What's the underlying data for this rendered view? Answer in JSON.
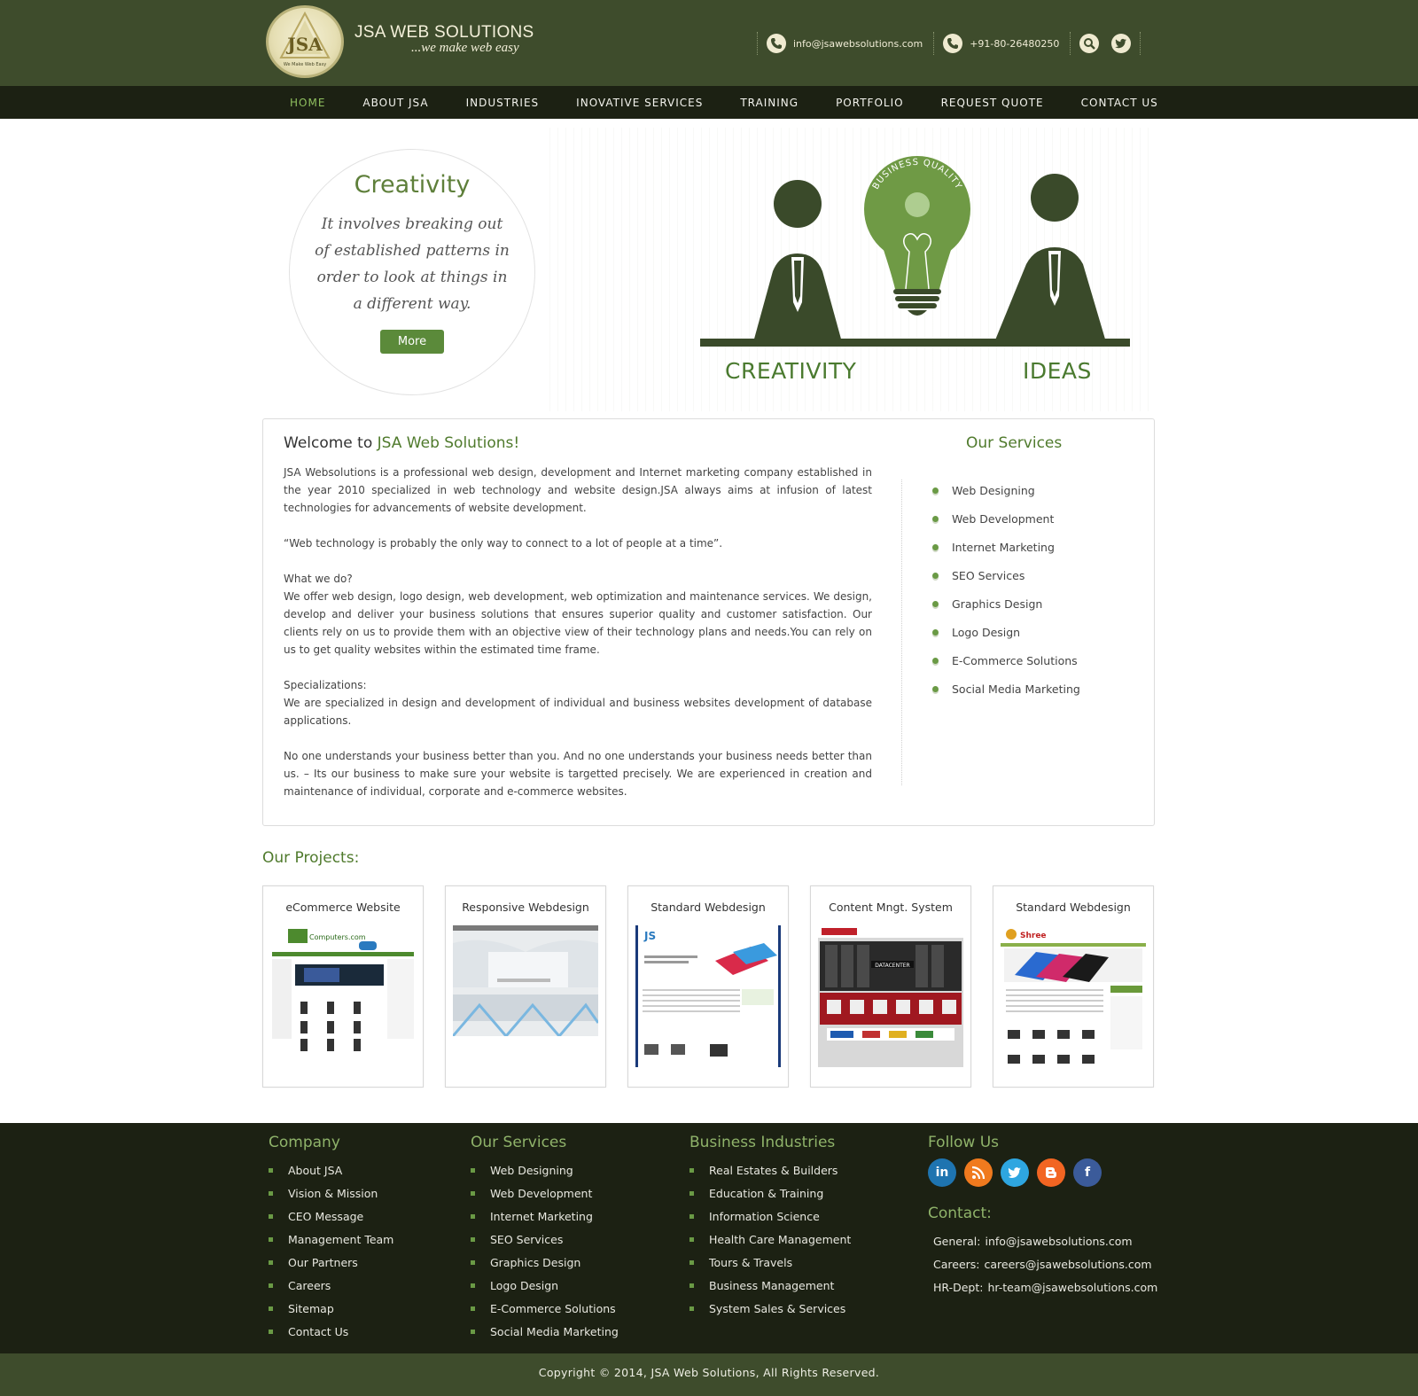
{
  "brand": {
    "name": "JSA WEB SOLUTIONS",
    "tagline": "...we make web easy",
    "logo_monogram": "JSA",
    "logo_motto": "We Make Web Easy"
  },
  "header_contacts": {
    "email": "info@jsawebsolutions.com",
    "phone": "+91-80-26480250"
  },
  "nav": {
    "items": [
      {
        "label": "HOME",
        "active": true
      },
      {
        "label": "ABOUT JSA",
        "active": false
      },
      {
        "label": "INDUSTRIES",
        "active": false
      },
      {
        "label": "INOVATIVE SERVICES",
        "active": false
      },
      {
        "label": "TRAINING",
        "active": false
      },
      {
        "label": "PORTFOLIO",
        "active": false
      },
      {
        "label": "REQUEST QUOTE",
        "active": false
      },
      {
        "label": "CONTACT US",
        "active": false
      }
    ]
  },
  "hero": {
    "title": "Creativity",
    "quote": "It involves breaking out of established patterns in order to look at things in a different way.",
    "button": "More",
    "bulb_text": "BUSINESS QUALITY",
    "label_left": "CREATIVITY",
    "label_right": "IDEAS"
  },
  "welcome": {
    "title_prefix": "Welcome to ",
    "title_brand": "JSA Web Solutions!",
    "p1": "JSA Websolutions is a professional web design, development and Internet marketing company established in the year 2010 specialized in web technology and website design.JSA always aims at infusion of latest technologies for advancements of website development.",
    "p2": "“Web technology is probably the only way to connect to a lot of people at a time”.",
    "p3_head": "What we do?",
    "p3": "We offer web design, logo design, web development, web optimization and maintenance services. We design, develop and deliver your business solutions that ensures superior quality and customer satisfaction. Our clients rely on us to provide them with an objective view of their technology plans and needs.You can rely on us to get quality websites within the estimated time frame.",
    "p4_head": "Specializations:",
    "p4": "We are specialized in design and development of individual and business websites development of database applications.",
    "p5": "No one understands your business better than you. And no one understands your business needs better than us. – Its our business to make sure your website is targetted precisely. We are experienced in creation and maintenance of individual, corporate and e-commerce websites."
  },
  "services": {
    "title": "Our Services",
    "items": [
      "Web Designing",
      "Web Development",
      "Internet Marketing",
      "SEO Services",
      "Graphics Design",
      "Logo Design",
      "E-Commerce Solutions",
      "Social Media Marketing"
    ]
  },
  "projects": {
    "title": "Our Projects:",
    "items": [
      {
        "name": "eCommerce Website",
        "thumb_text": "Computers.com"
      },
      {
        "name": "Responsive Webdesign"
      },
      {
        "name": "Standard Webdesign",
        "thumb_text": "JS"
      },
      {
        "name": "Content Mngt. System",
        "thumb_text": "DATACENTER"
      },
      {
        "name": "Standard Webdesign",
        "thumb_text": "Shree"
      }
    ]
  },
  "footer": {
    "company": {
      "title": "Company",
      "items": [
        "About JSA",
        "Vision & Mission",
        "CEO Message",
        "Management Team",
        "Our Partners",
        "Careers",
        "Sitemap",
        "Contact Us"
      ]
    },
    "services": {
      "title": "Our Services",
      "items": [
        "Web Designing",
        "Web Development",
        "Internet Marketing",
        "SEO Services",
        "Graphics Design",
        "Logo Design",
        "E-Commerce Solutions",
        "Social Media Marketing"
      ]
    },
    "industries": {
      "title": "Business Industries",
      "items": [
        "Real Estates & Builders",
        "Education & Training",
        "Information Science",
        "Health Care Management",
        "Tours & Travels",
        "Business Management",
        "System Sales & Services"
      ]
    },
    "follow": {
      "title": "Follow Us",
      "icons": [
        {
          "name": "linkedin-icon",
          "glyph": "in",
          "color": "#1e74b0"
        },
        {
          "name": "rss-icon",
          "glyph": "",
          "color": "#f07a1e"
        },
        {
          "name": "twitter-icon",
          "glyph": "",
          "color": "#2ea6e0"
        },
        {
          "name": "blogger-icon",
          "glyph": "",
          "color": "#f26522"
        },
        {
          "name": "facebook-icon",
          "glyph": "f",
          "color": "#3b5b9a"
        }
      ]
    },
    "contact": {
      "title": "Contact:",
      "lines": [
        {
          "label": "General:",
          "value": "info@jsawebsolutions.com"
        },
        {
          "label": "Careers:",
          "value": "careers@jsawebsolutions.com"
        },
        {
          "label": "HR-Dept:",
          "value": "hr-team@jsawebsolutions.com"
        }
      ]
    }
  },
  "copyright": "Copyright © 2014, JSA Web Solutions, All Rights Reserved.",
  "colors": {
    "header_bg": "#3e4c2c",
    "nav_bg": "#1c2113",
    "accent_green": "#4f7a2c",
    "button_green": "#5b8a3a",
    "nav_active": "#8fbf5f"
  }
}
